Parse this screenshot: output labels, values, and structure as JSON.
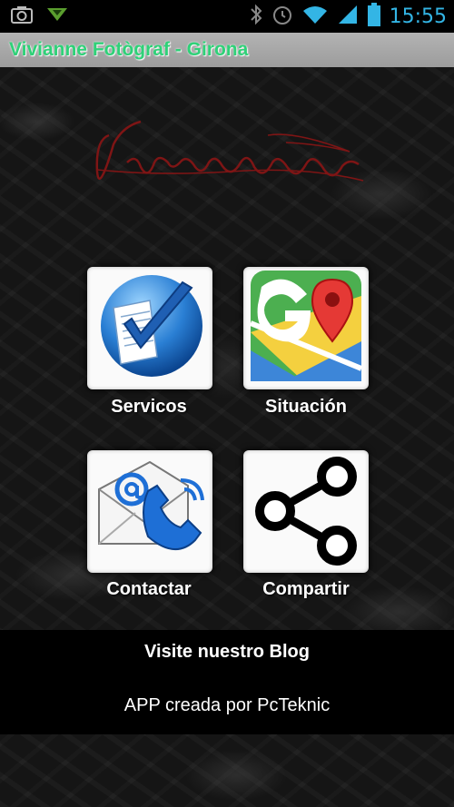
{
  "status_bar": {
    "time": "15:55",
    "icons": [
      "camera-icon",
      "download-icon",
      "bluetooth-icon",
      "alarm-icon",
      "wifi-icon",
      "signal-icon",
      "battery-icon"
    ]
  },
  "app": {
    "title": "Vivianne Fotògraf - Girona",
    "logo_text": "Vivianne"
  },
  "menu": {
    "items": [
      {
        "label": "Servicos",
        "icon": "document-check-icon"
      },
      {
        "label": "Situación",
        "icon": "google-maps-icon"
      },
      {
        "label": "Contactar",
        "icon": "email-phone-icon"
      },
      {
        "label": "Compartir",
        "icon": "share-icon"
      }
    ]
  },
  "footer": {
    "blog_link": "Visite nuestro Blog",
    "credit": "APP creada por PcTeknic"
  },
  "colors": {
    "status_clock": "#33b5e5",
    "title_text": "#2fd178",
    "logo": "#8b1a1a",
    "background": "#151515"
  }
}
